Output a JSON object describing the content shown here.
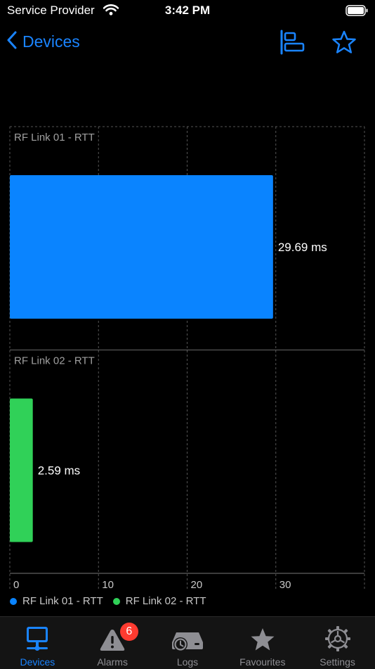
{
  "status_bar": {
    "carrier": "Service Provider",
    "time": "3:42 PM"
  },
  "nav": {
    "back_label": "Devices",
    "align_icon": "bar-chart-align-icon",
    "favourite_icon": "star-outline-icon"
  },
  "colors": {
    "accent": "#1a84ff",
    "series1": "#0a84ff",
    "series2": "#30d158",
    "badge": "#ff3b30"
  },
  "chart_data": {
    "type": "bar",
    "orientation": "horizontal",
    "panels": [
      {
        "title": "RF Link 01 - RTT",
        "value": 29.69,
        "label": "29.69 ms",
        "color": "#0a84ff"
      },
      {
        "title": "RF Link 02 - RTT",
        "value": 2.59,
        "label": "2.59 ms",
        "color": "#30d158"
      }
    ],
    "x_ticks": [
      0,
      10,
      20,
      30
    ],
    "xlim": [
      0,
      40
    ],
    "grid": true,
    "legend_position": "bottom-left",
    "series": [
      {
        "name": "RF Link 01 - RTT",
        "color": "#0a84ff"
      },
      {
        "name": "RF Link 02 - RTT",
        "color": "#30d158"
      }
    ]
  },
  "tabs": [
    {
      "label": "Devices",
      "icon": "monitor-network-icon",
      "active": true
    },
    {
      "label": "Alarms",
      "icon": "warning-triangle-icon",
      "badge": "6"
    },
    {
      "label": "Logs",
      "icon": "history-drive-icon"
    },
    {
      "label": "Favourites",
      "icon": "star-filled-icon"
    },
    {
      "label": "Settings",
      "icon": "gear-icon"
    }
  ]
}
